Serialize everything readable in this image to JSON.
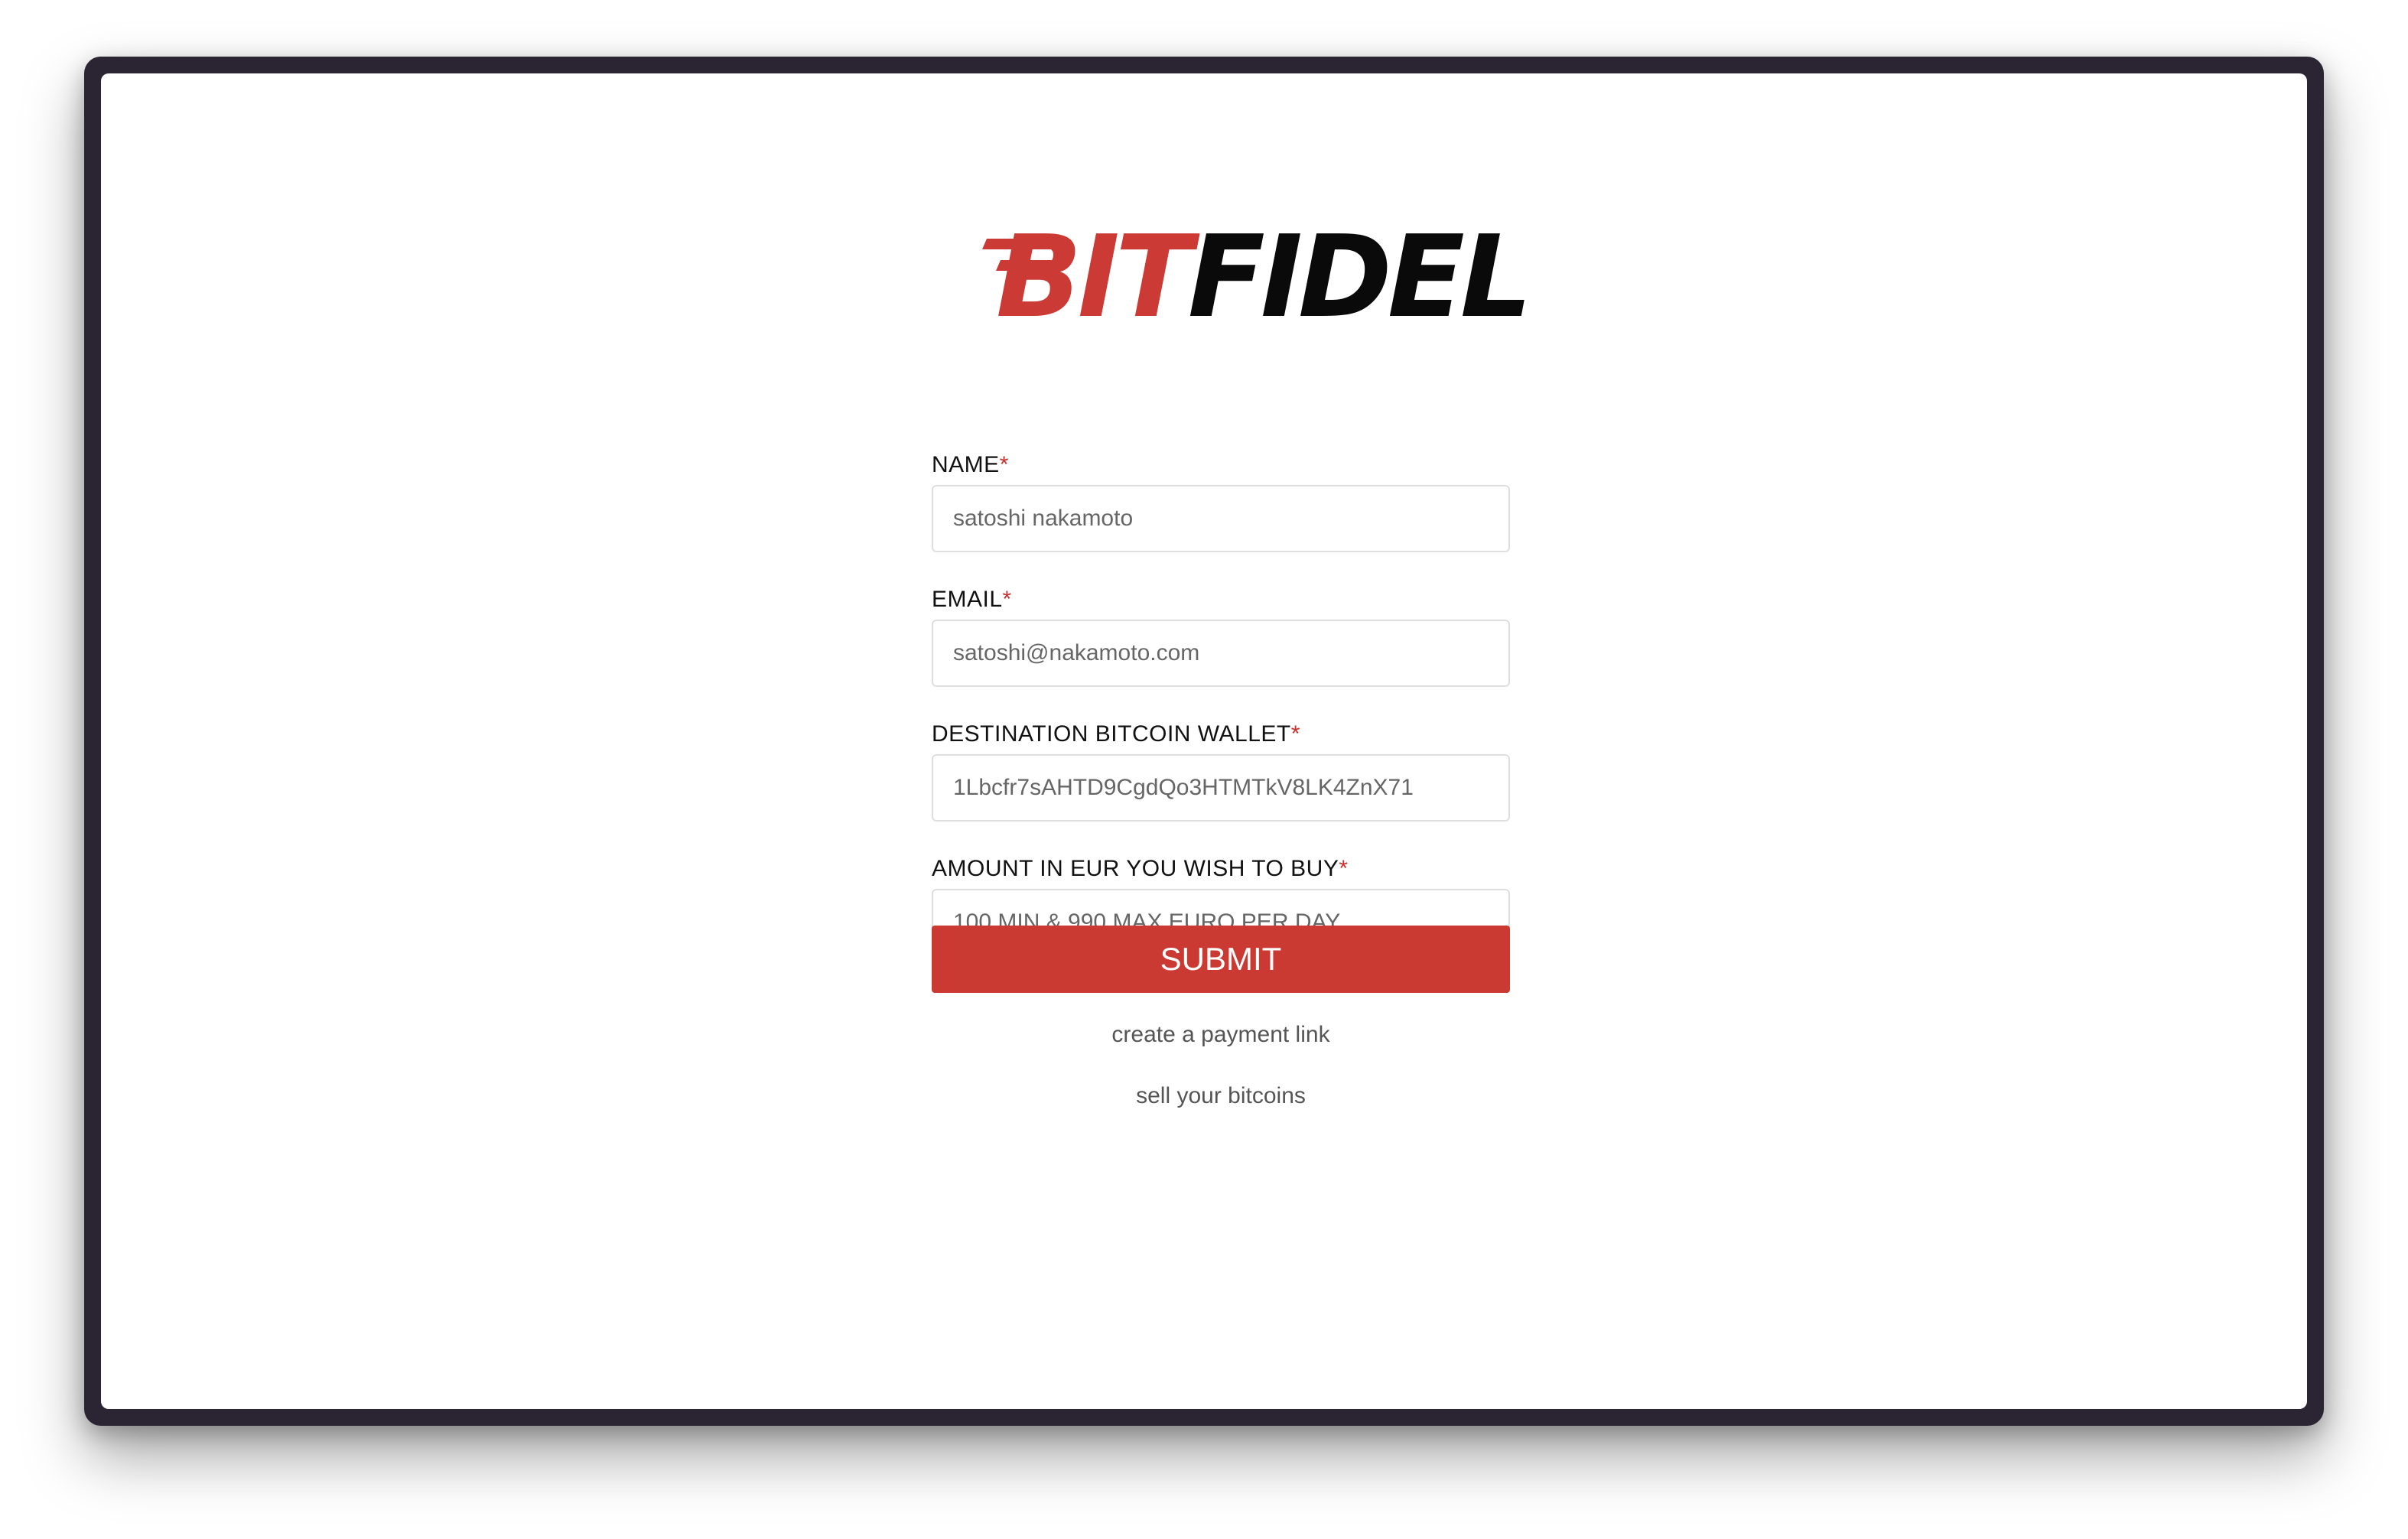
{
  "brand": {
    "logo_part1": "BIT",
    "logo_part2": "FIDEL",
    "accent_color": "#cb3a34",
    "dark_color": "#0a0a0a"
  },
  "form": {
    "fields": [
      {
        "label": "NAME",
        "required_mark": "*",
        "placeholder": "satoshi nakamoto",
        "value": ""
      },
      {
        "label": "EMAIL",
        "required_mark": "*",
        "placeholder": "satoshi@nakamoto.com",
        "value": ""
      },
      {
        "label": "DESTINATION BITCOIN WALLET",
        "required_mark": "*",
        "placeholder": "1Lbcfr7sAHTD9CgdQo3HTMTkV8LK4ZnX71",
        "value": ""
      },
      {
        "label": "AMOUNT IN EUR YOU WISH TO BUY",
        "required_mark": "*",
        "placeholder": "100 MIN & 990 MAX EURO PER DAY",
        "value": ""
      }
    ],
    "submit_label": "SUBMIT",
    "submit_color": "#cb3a32"
  },
  "links": {
    "payment_link": "create a payment link",
    "sell": "sell your bitcoins"
  }
}
